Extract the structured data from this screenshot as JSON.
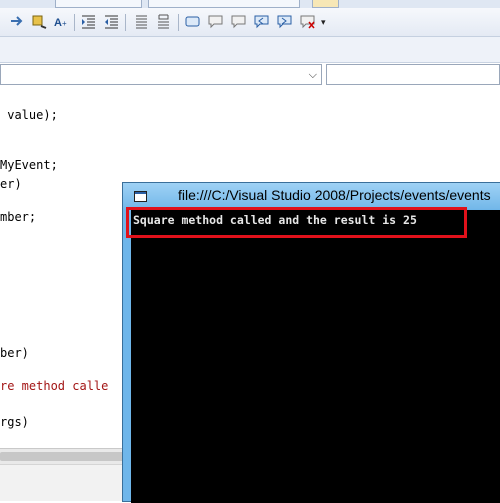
{
  "editor": {
    "lines": [
      " value);",
      "MyEvent;",
      "er)",
      "mber;",
      "ber)",
      "re method calle",
      "rgs)"
    ]
  },
  "console": {
    "title": "file:///C:/Visual Studio 2008/Projects/events/events",
    "output": "Square method called and the result is 25"
  },
  "icons": {
    "toolbar": [
      "arrow-right-icon",
      "watch-icon",
      "breakpoint-icon",
      "font-size-icon",
      "indent-icon",
      "outdent-icon",
      "align-icon",
      "format-icon",
      "comment-icon",
      "uncomment-icon",
      "bookmark-icon",
      "prev-bookmark-icon",
      "next-bookmark-icon",
      "clear-bookmark-icon"
    ]
  }
}
